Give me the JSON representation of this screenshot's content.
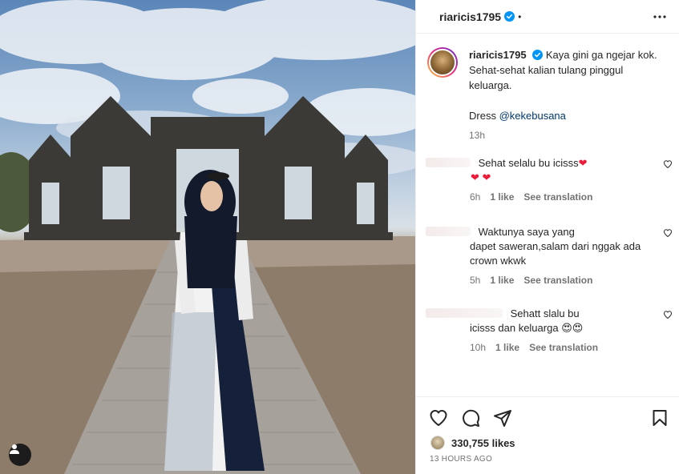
{
  "post": {
    "username": "riaricis1795",
    "dot": "•",
    "caption_line1": "Kaya gini ga ngejar kok.",
    "caption_line2": "Sehat-sehat kalian tulang pinggul",
    "caption_line3": "keluarga.",
    "dress_label": "Dress",
    "dress_mention": "@kekebusana",
    "time": "13h"
  },
  "comments": [
    {
      "text_line1": "Sehat selalu bu icisss",
      "emoji_after_line1": "❤",
      "text_line2": "❤ ❤",
      "time": "6h",
      "likes": "1 like",
      "translate": "See translation"
    },
    {
      "text_line1": "Waktunya saya yang",
      "text_line2": "dapet saweran,salam dari nggak ada",
      "text_line3": "crown wkwk",
      "time": "5h",
      "likes": "1 like",
      "translate": "See translation"
    },
    {
      "text_line1": "Sehatt slalu bu",
      "text_line2": "icisss dan keluarga",
      "emoji": "😍😍",
      "time": "10h",
      "likes": "1 like",
      "translate": "See translation"
    }
  ],
  "stats": {
    "likes_count": "330,755",
    "likes_label": "likes",
    "posted_ago": "13 HOURS AGO"
  },
  "colors": {
    "verified_blue": "#0095f6",
    "heart_red": "#ed1c3b",
    "mention_blue": "#00376b",
    "secondary_text": "#737373"
  },
  "icons": {
    "like": "heart-icon",
    "comment": "comment-icon",
    "share": "share-icon",
    "save": "bookmark-icon",
    "more": "more-options-icon",
    "user_tag": "user-tag-icon"
  }
}
